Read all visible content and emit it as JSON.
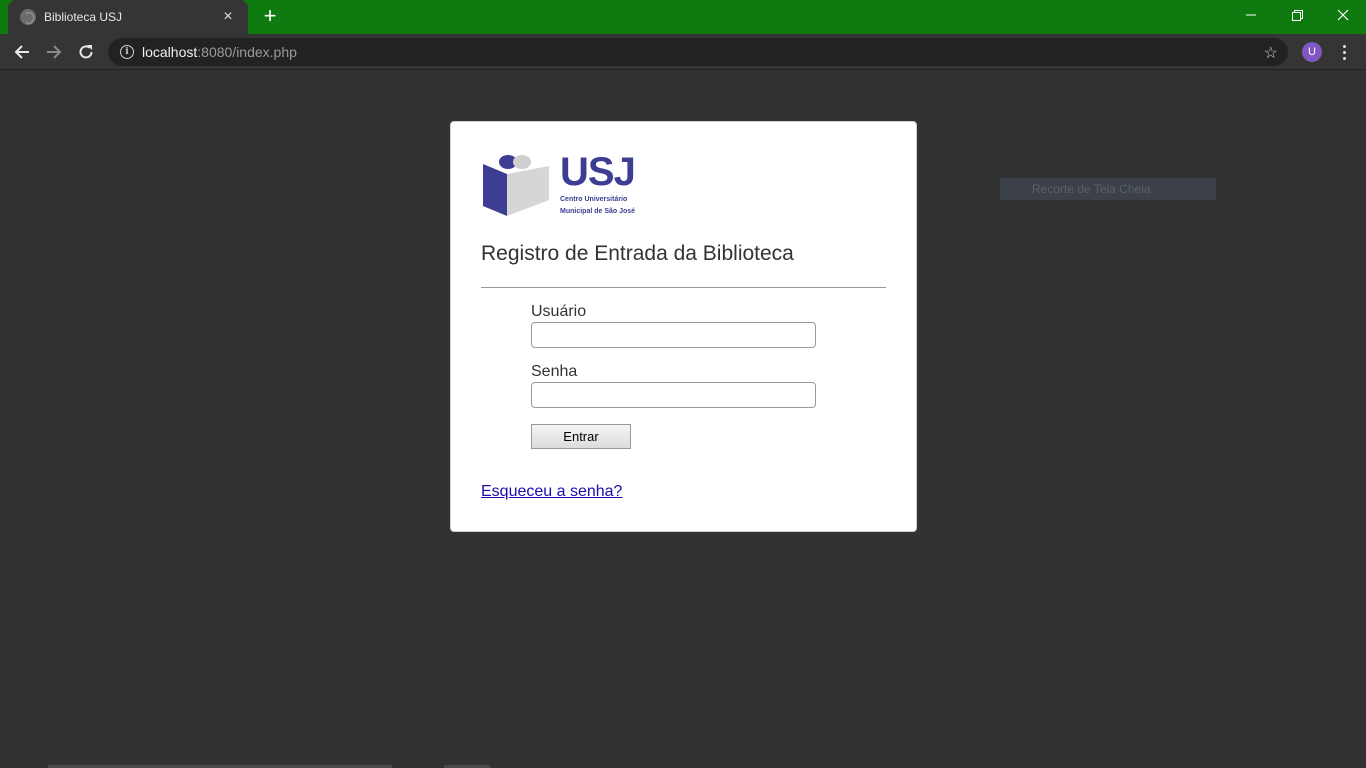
{
  "browser": {
    "tab_title": "Biblioteca USJ",
    "tab_close": "×",
    "new_tab": "+",
    "url_host": "localhost",
    "url_rest": ":8080/index.php",
    "avatar_letter": "U",
    "accent_color": "#0f7a0f"
  },
  "overlay": {
    "snip_label": "Recorte de Tela Cheia"
  },
  "logo": {
    "title": "USJ",
    "subtitle_line1": "Centro Universitário",
    "subtitle_line2": "Municipal de São José",
    "brand_color": "#3d3d93"
  },
  "login": {
    "heading": "Registro de Entrada da Biblioteca",
    "user_label": "Usuário",
    "user_value": "",
    "password_label": "Senha",
    "password_value": "",
    "submit_label": "Entrar",
    "forgot_link": "Esqueceu a senha?"
  },
  "icons": [
    "globe-icon",
    "close-icon",
    "plus-icon",
    "minimize-icon",
    "restore-icon",
    "window-close-icon",
    "back-arrow-icon",
    "forward-arrow-icon",
    "reload-icon",
    "info-icon",
    "star-icon",
    "kebab-menu-icon"
  ]
}
